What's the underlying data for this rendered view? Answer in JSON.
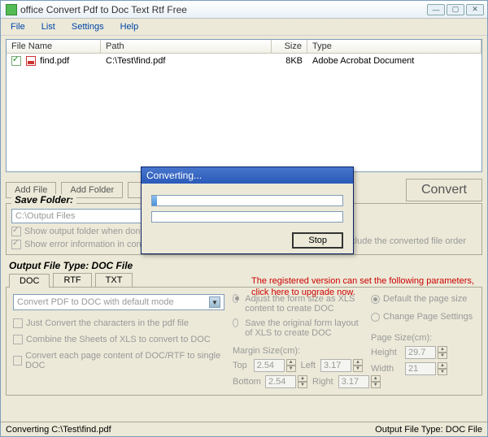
{
  "window": {
    "title": "office Convert Pdf to Doc Text Rtf Free"
  },
  "menu": {
    "file": "File",
    "list": "List",
    "settings": "Settings",
    "help": "Help"
  },
  "filelist": {
    "headers": {
      "name": "File Name",
      "path": "Path",
      "size": "Size",
      "type": "Type"
    },
    "row": {
      "name": "find.pdf",
      "path": "C:\\Test\\find.pdf",
      "size": "8KB",
      "type": "Adobe Acrobat Document"
    }
  },
  "buttons": {
    "addfile": "Add File",
    "addfolder": "Add Folder",
    "add3": "Ad",
    "convert": "Convert"
  },
  "savefolder": {
    "legend": "Save Folder:",
    "path": "C:\\Output Files",
    "cb_show": "Show output folder when done",
    "cb_error": "Show error information in convers",
    "cb_order": "Include the converted file order"
  },
  "output_label": "Output File Type:  DOC File",
  "upgrade": "The registered version can set the following parameters, click here to upgrade now.",
  "tabs": {
    "doc": "DOC",
    "rtf": "RTF",
    "txt": "TXT"
  },
  "panel": {
    "mode_select": "Convert PDF to DOC with default mode",
    "cb_chars": "Just Convert the characters in the pdf file",
    "cb_combine": "Combine the Sheets of XLS to convert to DOC",
    "cb_eachpage": "Convert each page content of DOC/RTF to single DOC",
    "rb_adjust": "Adjust the form size as XLS content to create DOC",
    "rb_save": "Save the original form layout of XLS to create DOC",
    "margin_label": "Margin Size(cm):",
    "top": "Top",
    "left": "Left",
    "bottom": "Bottom",
    "right": "Right",
    "v_top": "2.54",
    "v_left": "3.17",
    "v_bottom": "2.54",
    "v_right": "3.17",
    "rb_default": "Default the page size",
    "rb_change": "Change Page Settings",
    "page_label": "Page Size(cm):",
    "height": "Height",
    "width": "Width",
    "v_height": "29.7",
    "v_width": "21"
  },
  "status": {
    "left": "Converting  C:\\Test\\find.pdf",
    "right": "Output File Type:  DOC File"
  },
  "dialog": {
    "title": "Converting...",
    "stop": "Stop"
  }
}
